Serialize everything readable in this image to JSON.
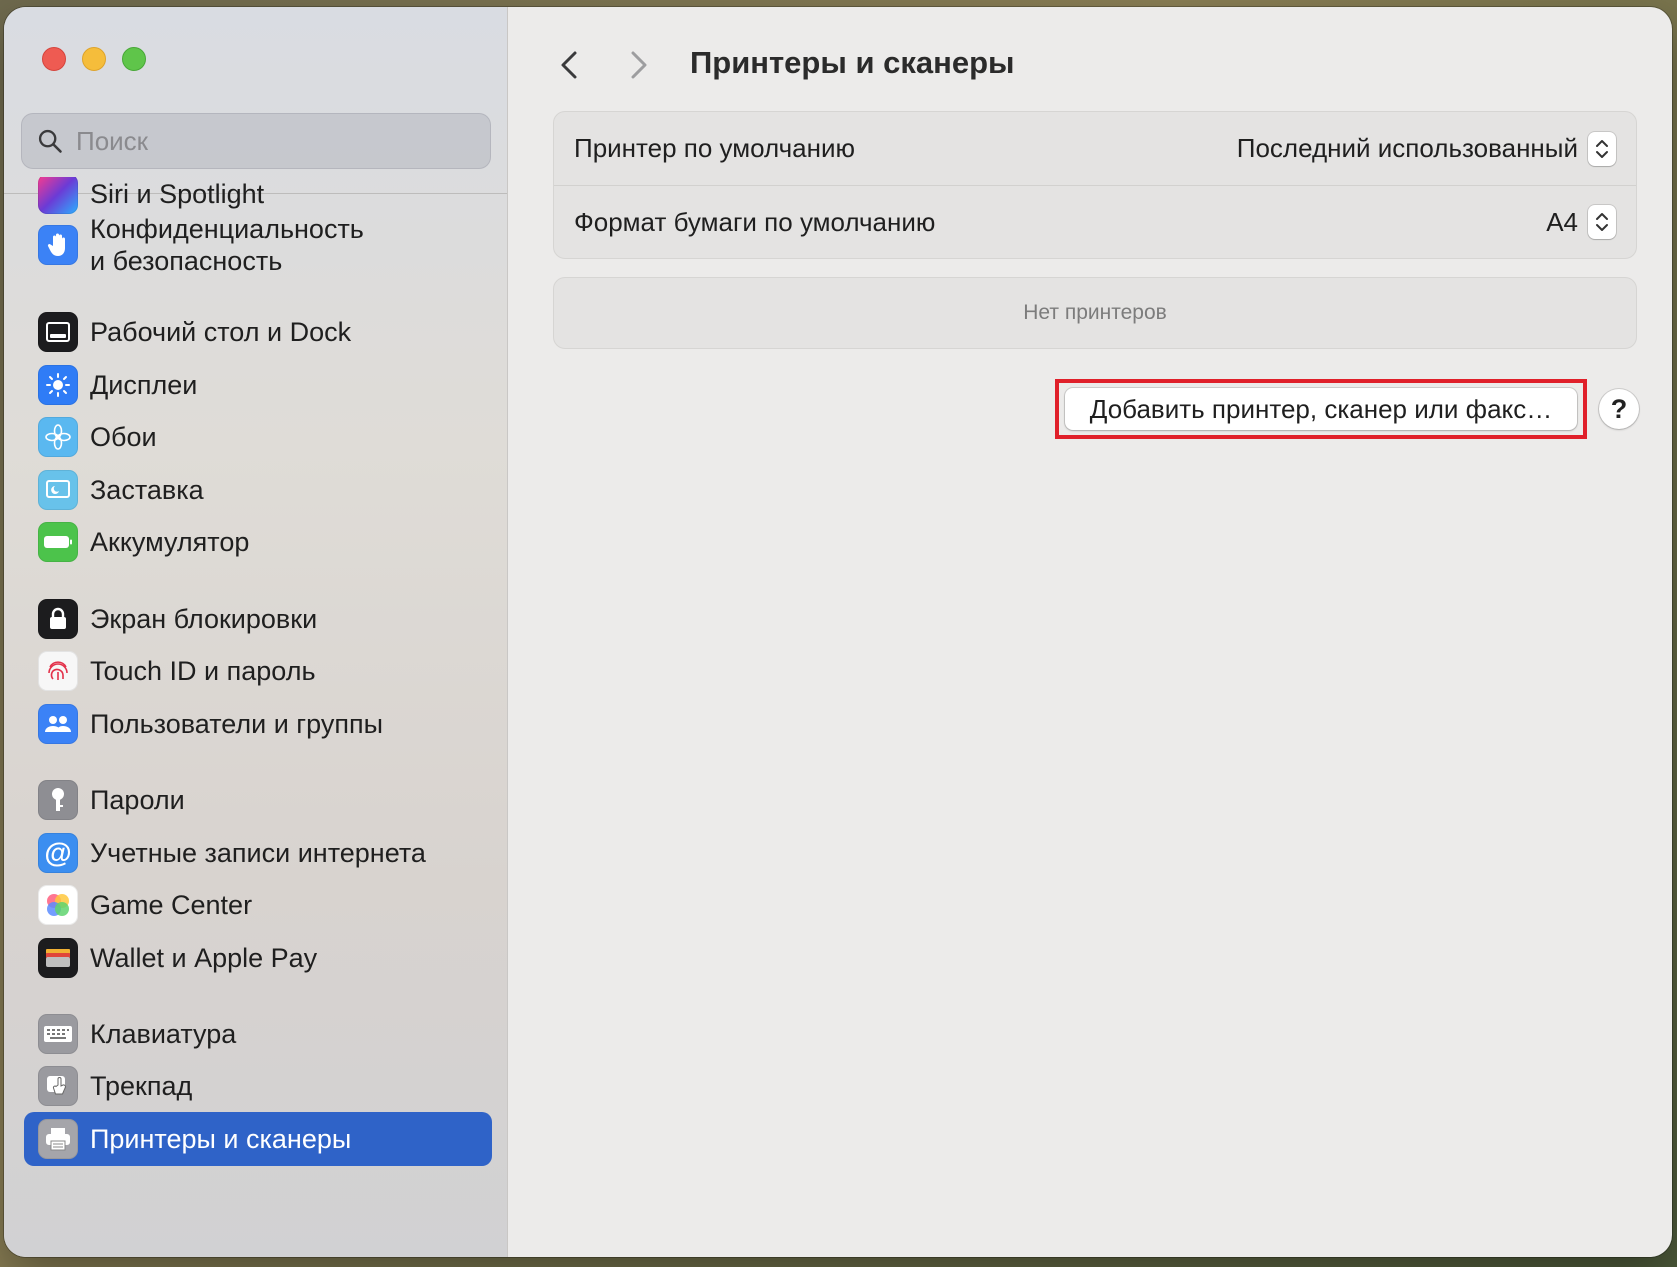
{
  "search": {
    "placeholder": "Поиск"
  },
  "sidebar": {
    "items": [
      {
        "label": "Siri и Spotlight",
        "icon": "siri-icon",
        "color": "#6b3bd6"
      },
      {
        "label": "Конфиденциальность\nи безопасность",
        "icon": "hand-icon",
        "color": "#3b82f6"
      },
      {
        "label": "Рабочий стол и Dock",
        "icon": "dock-icon",
        "color": "#1c1c1e"
      },
      {
        "label": "Дисплеи",
        "icon": "sun-icon",
        "color": "#2f7cf6"
      },
      {
        "label": "Обои",
        "icon": "flower-icon",
        "color": "#5ab8f0"
      },
      {
        "label": "Заставка",
        "icon": "screensaver-icon",
        "color": "#68c2ea"
      },
      {
        "label": "Аккумулятор",
        "icon": "battery-icon",
        "color": "#4cc34b"
      },
      {
        "label": "Экран блокировки",
        "icon": "lock-icon",
        "color": "#1c1c1e"
      },
      {
        "label": "Touch ID и пароль",
        "icon": "fingerprint-icon",
        "color": "#f5f5f5"
      },
      {
        "label": "Пользователи и группы",
        "icon": "users-icon",
        "color": "#3b82f6"
      },
      {
        "label": "Пароли",
        "icon": "key-icon",
        "color": "#8e8e93"
      },
      {
        "label": "Учетные записи интернета",
        "icon": "at-icon",
        "color": "#3b8ef0"
      },
      {
        "label": "Game Center",
        "icon": "game-center-icon",
        "color": "#ffffff"
      },
      {
        "label": "Wallet и Apple Pay",
        "icon": "wallet-icon",
        "color": "#1c1c1e"
      },
      {
        "label": "Клавиатура",
        "icon": "keyboard-icon",
        "color": "#9a9a9f"
      },
      {
        "label": "Трекпад",
        "icon": "trackpad-icon",
        "color": "#9a9a9f"
      },
      {
        "label": "Принтеры и сканеры",
        "icon": "printer-icon",
        "color": "#9a9a9f"
      }
    ]
  },
  "header": {
    "title": "Принтеры и сканеры"
  },
  "settings": {
    "default_printer_label": "Принтер по умолчанию",
    "default_printer_value": "Последний использованный",
    "paper_size_label": "Формат бумаги по умолчанию",
    "paper_size_value": "A4"
  },
  "printers": {
    "empty_text": "Нет принтеров"
  },
  "actions": {
    "add_label": "Добавить принтер, сканер или факс…",
    "help_label": "?"
  }
}
